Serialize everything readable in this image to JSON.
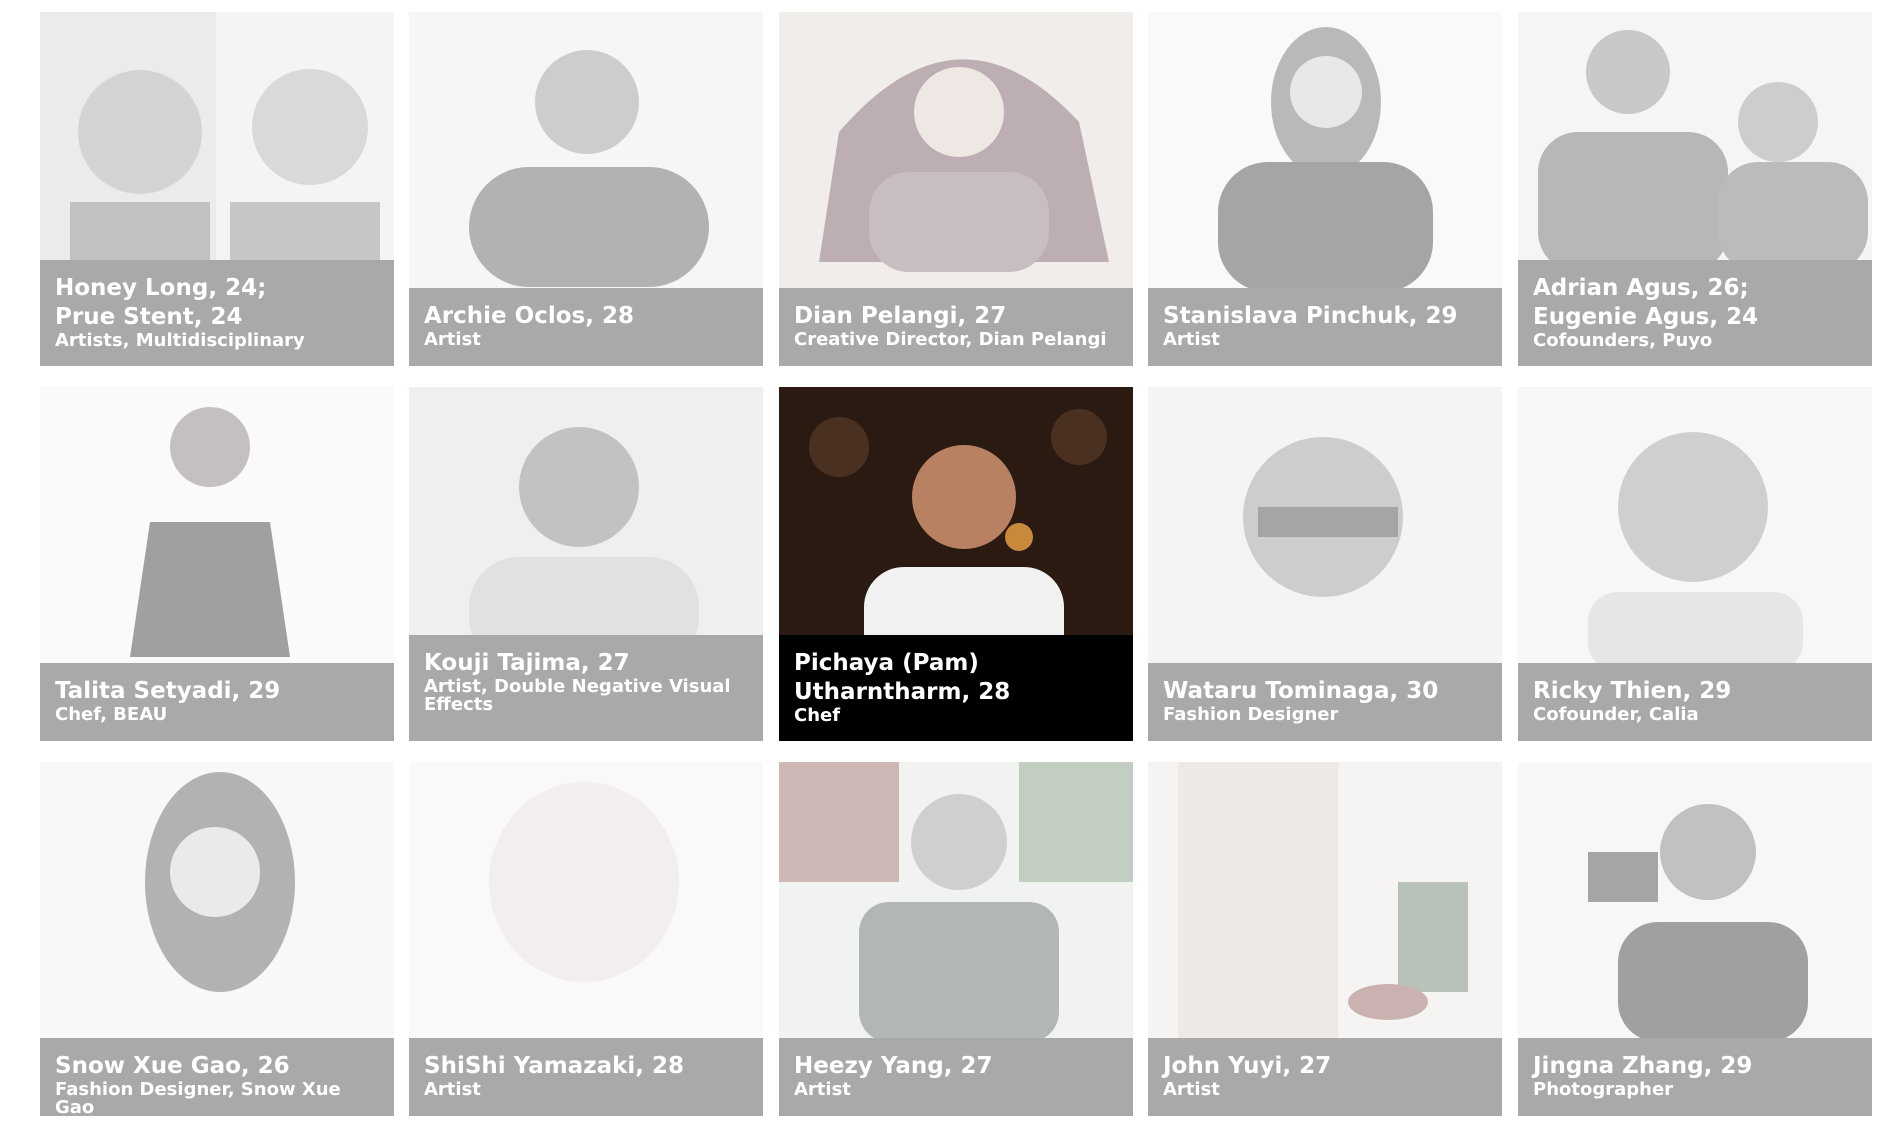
{
  "cards": [
    {
      "name": "Honey Long, 24;\nPrue Stent, 24",
      "role": "Artists, Multidisciplinary",
      "bg": "#e6e6e6"
    },
    {
      "name": "Archie Oclos, 28",
      "role": "Artist",
      "bg": "#ebebeb"
    },
    {
      "name": "Dian Pelangi, 27",
      "role": "Creative Director, Dian Pelangi",
      "bg": "#e7d3c6"
    },
    {
      "name": "Stanislava Pinchuk, 29",
      "role": "Artist",
      "bg": "#f1f1f1"
    },
    {
      "name": "Adrian Agus, 26;\nEugenie Agus, 24",
      "role": "Cofounders, Puyo",
      "bg": "#e8e8e8"
    },
    {
      "name": "Talita Setyadi, 29",
      "role": "Chef, BEAU",
      "bg": "#f4f4f4"
    },
    {
      "name": "Kouji Tajima, 27",
      "role": "Artist, Double Negative Visual\nEffects",
      "bg": "#e4e6e0"
    },
    {
      "name": "Pichaya (Pam)\nUtharntharm, 28",
      "role": "Chef",
      "bg": "#2b1a12"
    },
    {
      "name": "Wataru Tominaga, 30",
      "role": "Fashion Designer",
      "bg": "#e6e6e6"
    },
    {
      "name": "Ricky Thien, 29",
      "role": "Cofounder, Calia",
      "bg": "#f2eeec"
    },
    {
      "name": "Snow Xue Gao, 26",
      "role": "Fashion Designer, Snow Xue Gao",
      "bg": "#efefef"
    },
    {
      "name": "ShiShi Yamazaki, 28",
      "role": "Artist",
      "bg": "#f6f2f4"
    },
    {
      "name": "Heezy Yang, 27",
      "role": "Artist",
      "bg": "#d9e6d6"
    },
    {
      "name": "John Yuyi, 27",
      "role": "Artist",
      "bg": "#f0e4dc"
    },
    {
      "name": "Jingna Zhang, 29",
      "role": "Photographer",
      "bg": "#eeeeee"
    }
  ]
}
